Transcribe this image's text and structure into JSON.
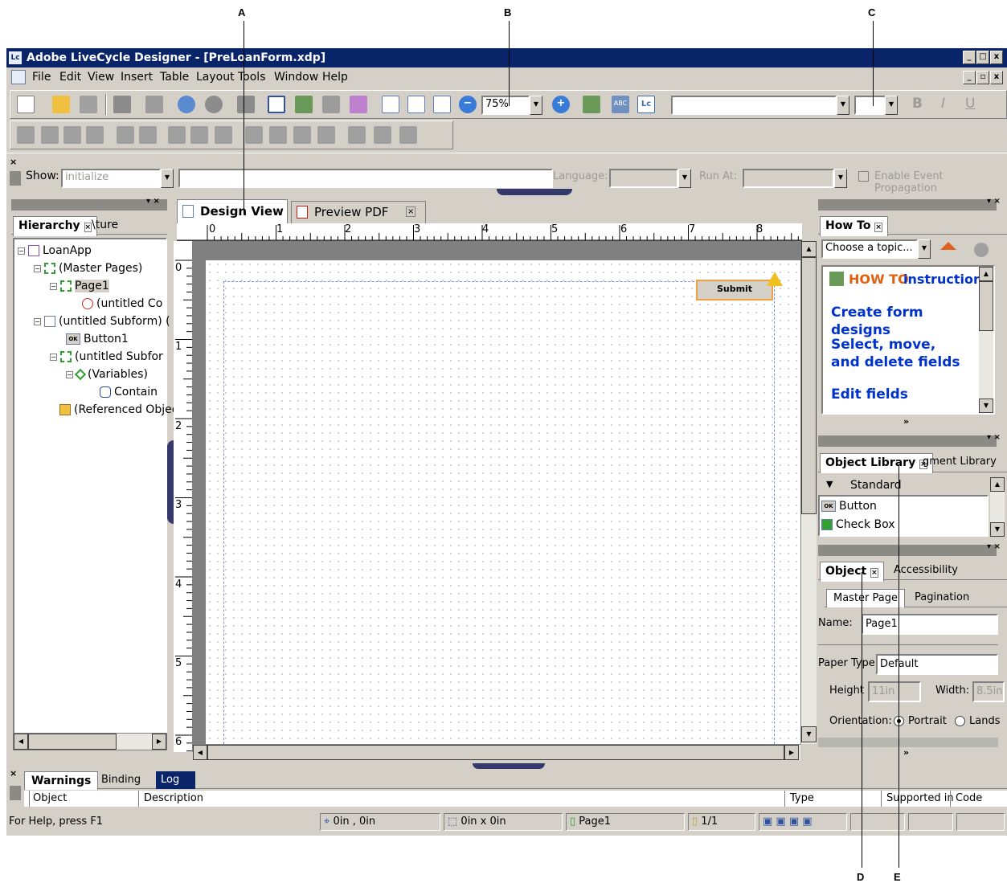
{
  "callouts": [
    "A",
    "B",
    "C",
    "D",
    "E"
  ],
  "window": {
    "title": "Adobe LiveCycle Designer - [PreLoanForm.xdp]",
    "app_icon": "Lc"
  },
  "menu": [
    "File",
    "Edit",
    "View",
    "Insert",
    "Table",
    "Layout",
    "Tools",
    "Window",
    "Help"
  ],
  "toolbar": {
    "zoom": "75%",
    "lc_badge": "Lc",
    "abc_badge": "ABC",
    "bold": "B",
    "italic": "I",
    "underline": "U"
  },
  "script_bar": {
    "show_label": "Show:",
    "show_value": "initialize",
    "language_label": "Language:",
    "run_at_label": "Run At:",
    "enable_event_propagation": "Enable Event Propagation"
  },
  "left_panel": {
    "tabs": [
      "Hierarchy",
      "\\ture"
    ],
    "tree": [
      "LoanApp",
      "(Master Pages)",
      "Page1",
      "(untitled Co",
      "(untitled Subform) (",
      "Button1",
      "(untitled Subfor",
      "(Variables)",
      "Contain",
      "(Referenced Object"
    ]
  },
  "editor": {
    "tabs": [
      "Design View",
      "Preview PDF"
    ],
    "ruler_h": [
      "0",
      "1",
      "2",
      "3",
      "4",
      "5",
      "6",
      "7",
      "8"
    ],
    "ruler_v": [
      "0",
      "1",
      "2",
      "3",
      "4",
      "5",
      "6"
    ],
    "submit_button": "Submit",
    "ok_badge": "OK"
  },
  "how_to": {
    "tab": "How To",
    "topic": "Choose a topic...",
    "heading_highlight": "HOW TO",
    "heading_rest": "instructions",
    "links": [
      "Create form designs",
      "Select, move, and delete fields",
      "Edit fields"
    ]
  },
  "object_library": {
    "tabs": [
      "Object Library",
      "gment Library"
    ],
    "group": "Standard",
    "items": [
      "Button",
      "Check Box"
    ]
  },
  "object_panel": {
    "tabs": [
      "Object",
      "Accessibility"
    ],
    "subtabs": [
      "Master Page",
      "Pagination"
    ],
    "name_label": "Name:",
    "name_value": "Page1",
    "paper_type_label": "Paper Type:",
    "paper_type_value": "Default",
    "height_label": "Height",
    "height_value": "11in",
    "width_label": "Width:",
    "width_value": "8.5in",
    "orientation_label": "Orientation:",
    "portrait": "Portrait",
    "landscape": "Lands"
  },
  "bottom_panel": {
    "tabs": [
      "Warnings",
      "Binding",
      "Log"
    ],
    "columns": [
      "Object",
      "Description",
      "Type",
      "Supported in",
      "Code"
    ]
  },
  "status": {
    "help": "For Help, press F1",
    "position": "0in , 0in",
    "size": "0in x 0in",
    "page": "Page1",
    "page_count": "1/1"
  }
}
